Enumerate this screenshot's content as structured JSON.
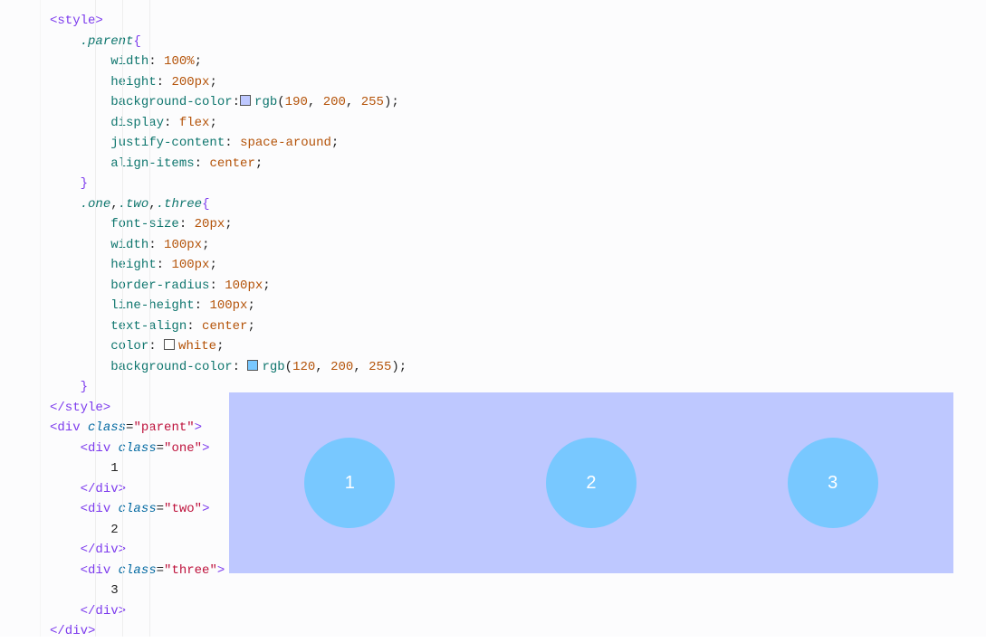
{
  "code": {
    "lines": [
      {
        "indent": 0,
        "tokens": [
          {
            "t": "<style>",
            "c": "tag"
          }
        ]
      },
      {
        "indent": 1,
        "tokens": [
          {
            "t": ".parent",
            "c": "sel"
          },
          {
            "t": "{",
            "c": "brace"
          }
        ]
      },
      {
        "indent": 2,
        "tokens": [
          {
            "t": "width",
            "c": "prop"
          },
          {
            "t": ": ",
            "c": "colon"
          },
          {
            "t": "100%",
            "c": "val"
          },
          {
            "t": ";",
            "c": "plain"
          }
        ]
      },
      {
        "indent": 2,
        "tokens": [
          {
            "t": "height",
            "c": "prop"
          },
          {
            "t": ": ",
            "c": "colon"
          },
          {
            "t": "200px",
            "c": "val"
          },
          {
            "t": ";",
            "c": "plain"
          }
        ]
      },
      {
        "indent": 2,
        "tokens": [
          {
            "t": "background-color",
            "c": "prop"
          },
          {
            "t": ":",
            "c": "colon"
          },
          {
            "swatch": "sw-parent"
          },
          {
            "t": "rgb",
            "c": "prop"
          },
          {
            "t": "(",
            "c": "plain"
          },
          {
            "t": "190",
            "c": "num"
          },
          {
            "t": ", ",
            "c": "plain"
          },
          {
            "t": "200",
            "c": "num"
          },
          {
            "t": ", ",
            "c": "plain"
          },
          {
            "t": "255",
            "c": "num"
          },
          {
            "t": ")",
            "c": "plain"
          },
          {
            "t": ";",
            "c": "plain"
          }
        ]
      },
      {
        "indent": 2,
        "tokens": [
          {
            "t": "display",
            "c": "prop"
          },
          {
            "t": ": ",
            "c": "colon"
          },
          {
            "t": "flex",
            "c": "val"
          },
          {
            "t": ";",
            "c": "plain"
          }
        ]
      },
      {
        "indent": 2,
        "tokens": [
          {
            "t": "justify-content",
            "c": "prop"
          },
          {
            "t": ": ",
            "c": "colon"
          },
          {
            "t": "space-around",
            "c": "val"
          },
          {
            "t": ";",
            "c": "plain"
          }
        ]
      },
      {
        "indent": 2,
        "tokens": [
          {
            "t": "align-items",
            "c": "prop"
          },
          {
            "t": ": ",
            "c": "colon"
          },
          {
            "t": "center",
            "c": "val"
          },
          {
            "t": ";",
            "c": "plain"
          }
        ]
      },
      {
        "indent": 1,
        "tokens": [
          {
            "t": "}",
            "c": "brace"
          }
        ]
      },
      {
        "indent": 1,
        "tokens": [
          {
            "t": ".one",
            "c": "sel"
          },
          {
            "t": ",",
            "c": "plain"
          },
          {
            "t": ".two",
            "c": "sel"
          },
          {
            "t": ",",
            "c": "plain"
          },
          {
            "t": ".three",
            "c": "sel"
          },
          {
            "t": "{",
            "c": "brace"
          }
        ]
      },
      {
        "indent": 2,
        "tokens": [
          {
            "t": "font-size",
            "c": "prop"
          },
          {
            "t": ": ",
            "c": "colon"
          },
          {
            "t": "20px",
            "c": "val"
          },
          {
            "t": ";",
            "c": "plain"
          }
        ]
      },
      {
        "indent": 2,
        "tokens": [
          {
            "t": "width",
            "c": "prop"
          },
          {
            "t": ": ",
            "c": "colon"
          },
          {
            "t": "100px",
            "c": "val"
          },
          {
            "t": ";",
            "c": "plain"
          }
        ]
      },
      {
        "indent": 2,
        "tokens": [
          {
            "t": "height",
            "c": "prop"
          },
          {
            "t": ": ",
            "c": "colon"
          },
          {
            "t": "100px",
            "c": "val"
          },
          {
            "t": ";",
            "c": "plain"
          }
        ]
      },
      {
        "indent": 2,
        "tokens": [
          {
            "t": "border-radius",
            "c": "prop"
          },
          {
            "t": ": ",
            "c": "colon"
          },
          {
            "t": "100px",
            "c": "val"
          },
          {
            "t": ";",
            "c": "plain"
          }
        ]
      },
      {
        "indent": 2,
        "tokens": [
          {
            "t": "line-height",
            "c": "prop"
          },
          {
            "t": ": ",
            "c": "colon"
          },
          {
            "t": "100px",
            "c": "val"
          },
          {
            "t": ";",
            "c": "plain"
          }
        ]
      },
      {
        "indent": 2,
        "tokens": [
          {
            "t": "text-align",
            "c": "prop"
          },
          {
            "t": ": ",
            "c": "colon"
          },
          {
            "t": "center",
            "c": "val"
          },
          {
            "t": ";",
            "c": "plain"
          }
        ]
      },
      {
        "indent": 2,
        "tokens": [
          {
            "t": "color",
            "c": "prop"
          },
          {
            "t": ": ",
            "c": "colon"
          },
          {
            "swatch": "sw-white"
          },
          {
            "t": "white",
            "c": "val"
          },
          {
            "t": ";",
            "c": "plain"
          }
        ]
      },
      {
        "indent": 2,
        "tokens": [
          {
            "t": "background-color",
            "c": "prop"
          },
          {
            "t": ": ",
            "c": "colon"
          },
          {
            "swatch": "sw-circle"
          },
          {
            "t": "rgb",
            "c": "prop"
          },
          {
            "t": "(",
            "c": "plain"
          },
          {
            "t": "120",
            "c": "num"
          },
          {
            "t": ", ",
            "c": "plain"
          },
          {
            "t": "200",
            "c": "num"
          },
          {
            "t": ", ",
            "c": "plain"
          },
          {
            "t": "255",
            "c": "num"
          },
          {
            "t": ")",
            "c": "plain"
          },
          {
            "t": ";",
            "c": "plain"
          }
        ]
      },
      {
        "indent": 1,
        "tokens": [
          {
            "t": "}",
            "c": "brace"
          }
        ]
      },
      {
        "indent": 0,
        "tokens": [
          {
            "t": "</style>",
            "c": "tag"
          }
        ]
      },
      {
        "indent": 0,
        "tokens": [
          {
            "t": "<div ",
            "c": "tag"
          },
          {
            "t": "class",
            "c": "attr-i"
          },
          {
            "t": "=",
            "c": "eq"
          },
          {
            "t": "\"parent\"",
            "c": "str"
          },
          {
            "t": ">",
            "c": "tag"
          }
        ]
      },
      {
        "indent": 1,
        "tokens": [
          {
            "t": "<div ",
            "c": "tag"
          },
          {
            "t": "class",
            "c": "attr-i"
          },
          {
            "t": "=",
            "c": "eq"
          },
          {
            "t": "\"one\"",
            "c": "str"
          },
          {
            "t": ">",
            "c": "tag"
          }
        ]
      },
      {
        "indent": 2,
        "tokens": [
          {
            "t": "1",
            "c": "plain"
          }
        ]
      },
      {
        "indent": 1,
        "tokens": [
          {
            "t": "</div>",
            "c": "tag"
          }
        ]
      },
      {
        "indent": 1,
        "tokens": [
          {
            "t": "<div ",
            "c": "tag"
          },
          {
            "t": "class",
            "c": "attr-i"
          },
          {
            "t": "=",
            "c": "eq"
          },
          {
            "t": "\"two\"",
            "c": "str"
          },
          {
            "t": ">",
            "c": "tag"
          }
        ]
      },
      {
        "indent": 2,
        "tokens": [
          {
            "t": "2",
            "c": "plain"
          }
        ]
      },
      {
        "indent": 1,
        "tokens": [
          {
            "t": "</div>",
            "c": "tag"
          }
        ]
      },
      {
        "indent": 1,
        "tokens": [
          {
            "t": "<div ",
            "c": "tag"
          },
          {
            "t": "class",
            "c": "attr-i"
          },
          {
            "t": "=",
            "c": "eq"
          },
          {
            "t": "\"three\"",
            "c": "str"
          },
          {
            "t": ">",
            "c": "tag"
          }
        ]
      },
      {
        "indent": 2,
        "tokens": [
          {
            "t": "3",
            "c": "plain"
          }
        ]
      },
      {
        "indent": 1,
        "tokens": [
          {
            "t": "</div>",
            "c": "tag"
          }
        ]
      },
      {
        "indent": 0,
        "tokens": [
          {
            "t": "</div>",
            "c": "tag"
          }
        ]
      }
    ]
  },
  "preview": {
    "circles": [
      "1",
      "2",
      "3"
    ]
  }
}
